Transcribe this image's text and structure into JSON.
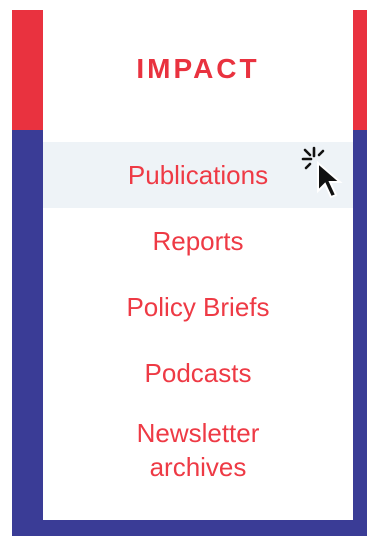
{
  "menu": {
    "heading": "IMPACT",
    "items": [
      {
        "label": "Publications",
        "hovered": true
      },
      {
        "label": "Reports",
        "hovered": false
      },
      {
        "label": "Policy Briefs",
        "hovered": false
      },
      {
        "label": "Podcasts",
        "hovered": false
      },
      {
        "label": "Newsletter archives",
        "hovered": false
      }
    ]
  },
  "colors": {
    "accent_red": "#e9323f",
    "frame_navy": "#3a3c96",
    "hover_background": "#eef3f7"
  },
  "cursor": {
    "icon": "arrow-pointer-with-click-burst-icon"
  }
}
